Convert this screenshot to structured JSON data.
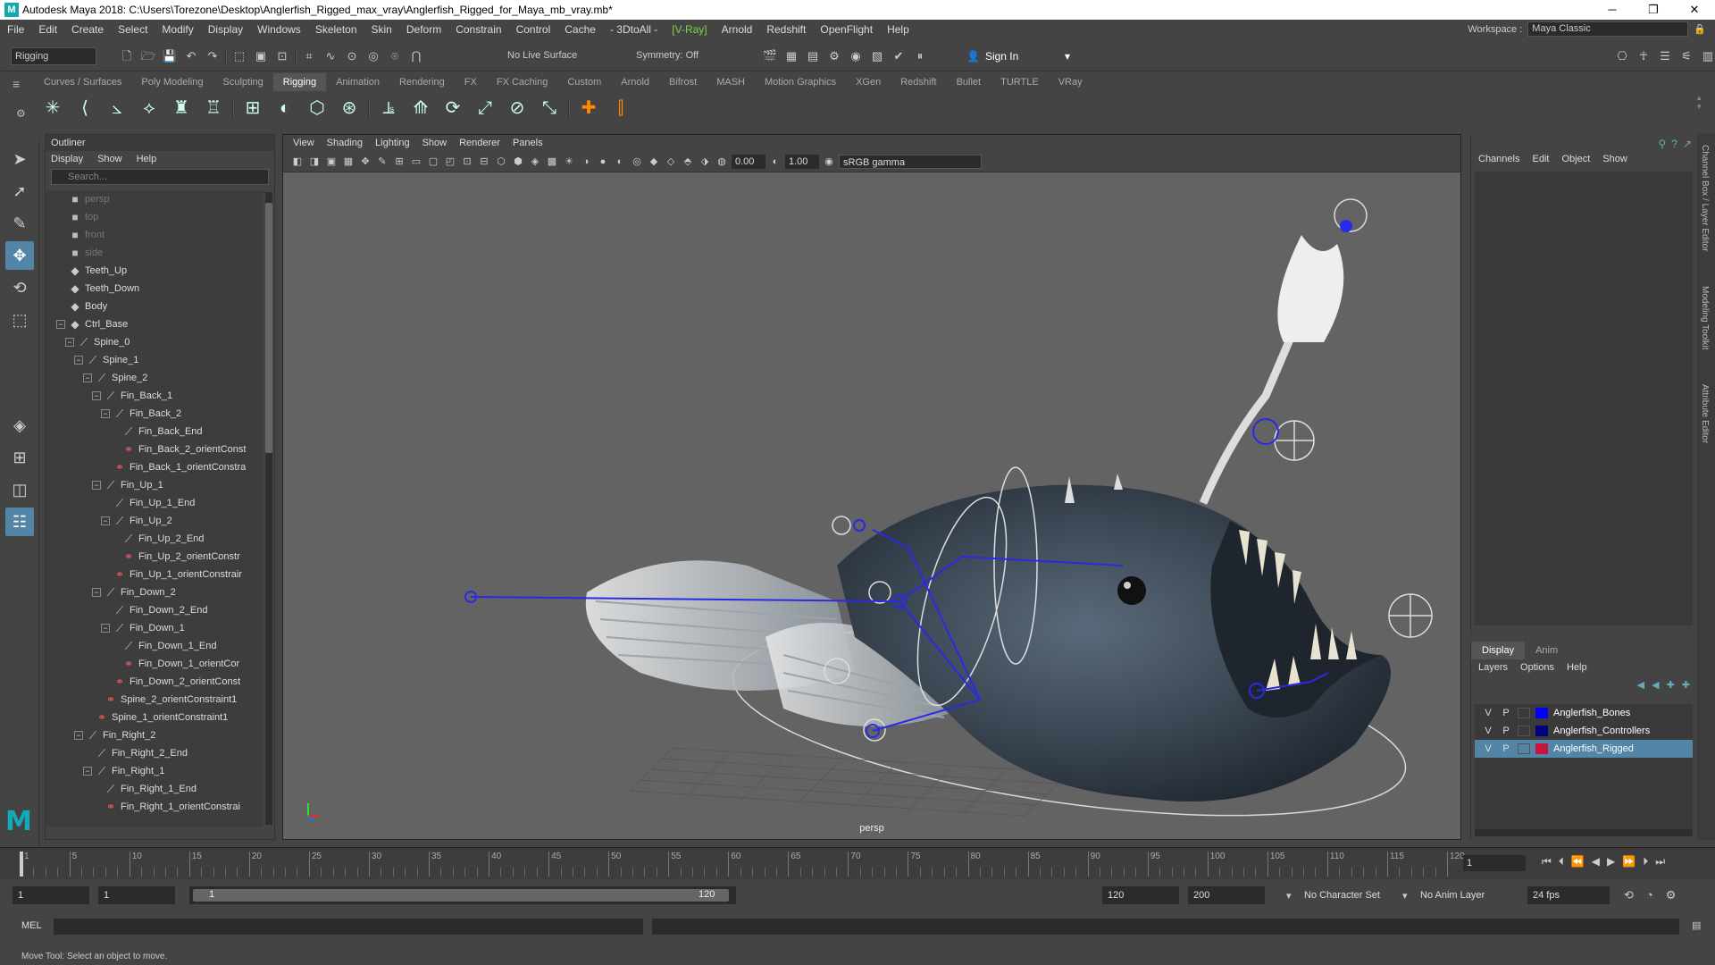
{
  "window": {
    "title": "Autodesk Maya 2018: C:\\Users\\Torezone\\Desktop\\Anglerfish_Rigged_max_vray\\Anglerfish_Rigged_for_Maya_mb_vray.mb*",
    "minimize": "─",
    "maximize": "❐",
    "close": "✕"
  },
  "menus": [
    "File",
    "Edit",
    "Create",
    "Select",
    "Modify",
    "Display",
    "Windows",
    "Skeleton",
    "Skin",
    "Deform",
    "Constrain",
    "Control",
    "Cache",
    "- 3DtoAll -",
    "[V-Ray]",
    "Arnold",
    "Redshift",
    "OpenFlight",
    "Help"
  ],
  "workspace": {
    "label": "Workspace :",
    "value": "Maya Classic"
  },
  "statusline": {
    "mode": "Rigging",
    "live_surface": "No Live Surface",
    "symmetry": "Symmetry: Off",
    "sign_in": "Sign In"
  },
  "shelf_tabs": [
    "Curves / Surfaces",
    "Poly Modeling",
    "Sculpting",
    "Rigging",
    "Animation",
    "Rendering",
    "FX",
    "FX Caching",
    "Custom",
    "Arnold",
    "Bifrost",
    "MASH",
    "Motion Graphics",
    "XGen",
    "Redshift",
    "Bullet",
    "TURTLE",
    "VRay"
  ],
  "active_shelf": "Rigging",
  "outliner": {
    "title": "Outliner",
    "menu": [
      "Display",
      "Show",
      "Help"
    ],
    "search_placeholder": "Search...",
    "items": [
      {
        "label": "persp",
        "depth": 0,
        "type": "camera",
        "dim": true,
        "expand": ""
      },
      {
        "label": "top",
        "depth": 0,
        "type": "camera",
        "dim": true,
        "expand": ""
      },
      {
        "label": "front",
        "depth": 0,
        "type": "camera",
        "dim": true,
        "expand": ""
      },
      {
        "label": "side",
        "depth": 0,
        "type": "camera",
        "dim": true,
        "expand": ""
      },
      {
        "label": "Teeth_Up",
        "depth": 0,
        "type": "mesh",
        "dim": false,
        "expand": ""
      },
      {
        "label": "Teeth_Down",
        "depth": 0,
        "type": "mesh",
        "dim": false,
        "expand": ""
      },
      {
        "label": "Body",
        "depth": 0,
        "type": "mesh",
        "dim": false,
        "expand": ""
      },
      {
        "label": "Ctrl_Base",
        "depth": 0,
        "type": "mesh",
        "dim": false,
        "expand": "−"
      },
      {
        "label": "Spine_0",
        "depth": 1,
        "type": "joint",
        "dim": false,
        "expand": "−"
      },
      {
        "label": "Spine_1",
        "depth": 2,
        "type": "joint",
        "dim": false,
        "expand": "−"
      },
      {
        "label": "Spine_2",
        "depth": 3,
        "type": "joint",
        "dim": false,
        "expand": "−"
      },
      {
        "label": "Fin_Back_1",
        "depth": 4,
        "type": "joint",
        "dim": false,
        "expand": "−"
      },
      {
        "label": "Fin_Back_2",
        "depth": 5,
        "type": "joint",
        "dim": false,
        "expand": "−"
      },
      {
        "label": "Fin_Back_End",
        "depth": 6,
        "type": "joint",
        "dim": false,
        "expand": ""
      },
      {
        "label": "Fin_Back_2_orientConst",
        "depth": 6,
        "type": "constraint",
        "dim": false,
        "expand": ""
      },
      {
        "label": "Fin_Back_1_orientConstra",
        "depth": 5,
        "type": "constraint",
        "dim": false,
        "expand": ""
      },
      {
        "label": "Fin_Up_1",
        "depth": 4,
        "type": "joint",
        "dim": false,
        "expand": "−"
      },
      {
        "label": "Fin_Up_1_End",
        "depth": 5,
        "type": "joint",
        "dim": false,
        "expand": ""
      },
      {
        "label": "Fin_Up_2",
        "depth": 5,
        "type": "joint",
        "dim": false,
        "expand": "−"
      },
      {
        "label": "Fin_Up_2_End",
        "depth": 6,
        "type": "joint",
        "dim": false,
        "expand": ""
      },
      {
        "label": "Fin_Up_2_orientConstr",
        "depth": 6,
        "type": "constraint",
        "dim": false,
        "expand": ""
      },
      {
        "label": "Fin_Up_1_orientConstrair",
        "depth": 5,
        "type": "constraint",
        "dim": false,
        "expand": ""
      },
      {
        "label": "Fin_Down_2",
        "depth": 4,
        "type": "joint",
        "dim": false,
        "expand": "−"
      },
      {
        "label": "Fin_Down_2_End",
        "depth": 5,
        "type": "joint",
        "dim": false,
        "expand": ""
      },
      {
        "label": "Fin_Down_1",
        "depth": 5,
        "type": "joint",
        "dim": false,
        "expand": "−"
      },
      {
        "label": "Fin_Down_1_End",
        "depth": 6,
        "type": "joint",
        "dim": false,
        "expand": ""
      },
      {
        "label": "Fin_Down_1_orientCor",
        "depth": 6,
        "type": "constraint",
        "dim": false,
        "expand": ""
      },
      {
        "label": "Fin_Down_2_orientConst",
        "depth": 5,
        "type": "constraint",
        "dim": false,
        "expand": ""
      },
      {
        "label": "Spine_2_orientConstraint1",
        "depth": 4,
        "type": "constraint",
        "dim": false,
        "expand": ""
      },
      {
        "label": "Spine_1_orientConstraint1",
        "depth": 3,
        "type": "constraint",
        "dim": false,
        "expand": ""
      },
      {
        "label": "Fin_Right_2",
        "depth": 2,
        "type": "joint",
        "dim": false,
        "expand": "−"
      },
      {
        "label": "Fin_Right_2_End",
        "depth": 3,
        "type": "joint",
        "dim": false,
        "expand": ""
      },
      {
        "label": "Fin_Right_1",
        "depth": 3,
        "type": "joint",
        "dim": false,
        "expand": "−"
      },
      {
        "label": "Fin_Right_1_End",
        "depth": 4,
        "type": "joint",
        "dim": false,
        "expand": ""
      },
      {
        "label": "Fin_Right_1_orientConstrai",
        "depth": 4,
        "type": "constraint",
        "dim": false,
        "expand": ""
      }
    ]
  },
  "viewport": {
    "menu": [
      "View",
      "Shading",
      "Lighting",
      "Show",
      "Renderer",
      "Panels"
    ],
    "exposure": "0.00",
    "gamma": "1.00",
    "color_space": "sRGB gamma",
    "camera_label": "persp"
  },
  "channelbox": {
    "menu": [
      "Channels",
      "Edit",
      "Object",
      "Show"
    ]
  },
  "side_tabs": [
    "Channel Box / Layer Editor",
    "Modeling Toolkit",
    "Attribute Editor"
  ],
  "layers": {
    "tabs": [
      "Display",
      "Anim"
    ],
    "menu": [
      "Layers",
      "Options",
      "Help"
    ],
    "rows": [
      {
        "v": "V",
        "p": "P",
        "name": "Anglerfish_Bones",
        "color": "#0000ff",
        "selected": false
      },
      {
        "v": "V",
        "p": "P",
        "name": "Anglerfish_Controllers",
        "color": "#000080",
        "selected": false
      },
      {
        "v": "V",
        "p": "P",
        "name": "Anglerfish_Rigged",
        "color": "#c8143c",
        "selected": true
      }
    ]
  },
  "timeline": {
    "ticks": [
      "1",
      "5",
      "10",
      "15",
      "20",
      "25",
      "30",
      "35",
      "40",
      "45",
      "50",
      "55",
      "60",
      "65",
      "70",
      "75",
      "80",
      "85",
      "90",
      "95",
      "100",
      "105",
      "110",
      "115",
      "120"
    ],
    "current_frame": "1"
  },
  "range": {
    "start": "1",
    "playback_start": "1",
    "slider_start": "1",
    "slider_end": "120",
    "playback_end": "120",
    "end": "200",
    "character_set": "No Character Set",
    "anim_layer": "No Anim Layer",
    "fps": "24 fps"
  },
  "cmdline": {
    "label": "MEL"
  },
  "helpline": "Move Tool: Select an object to move."
}
